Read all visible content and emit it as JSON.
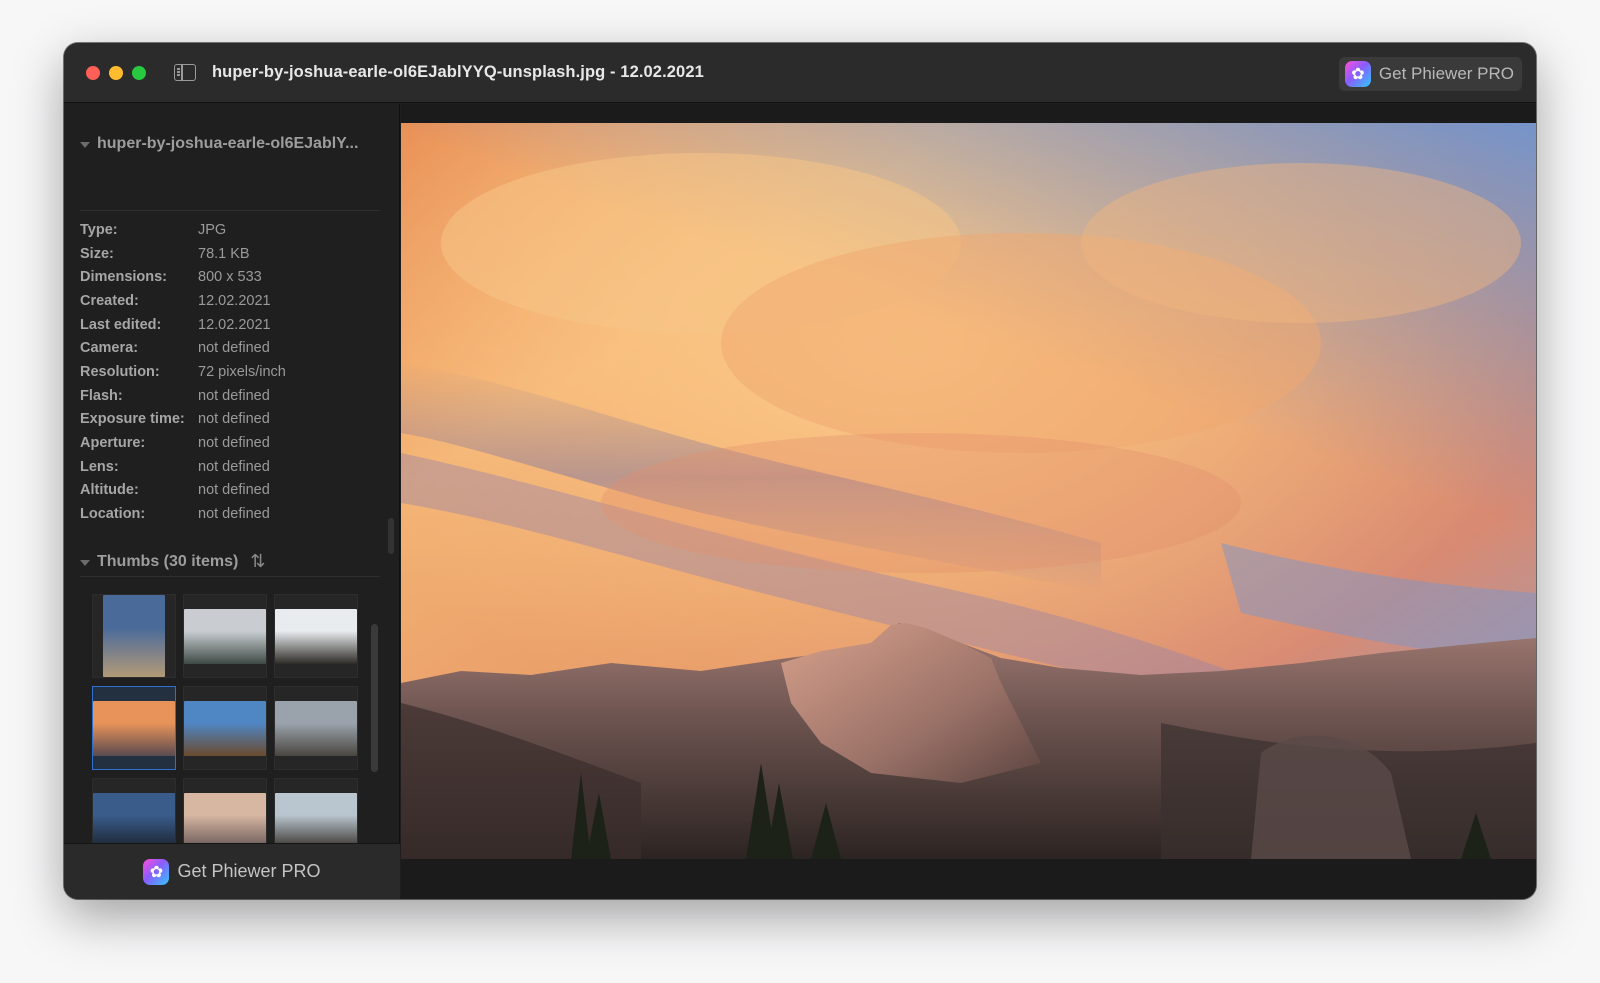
{
  "window": {
    "title": "huper-by-joshua-earle-ol6EJablYYQ-unsplash.jpg - 12.02.2021",
    "pro_button_label": "Get Phiewer PRO"
  },
  "sidebar": {
    "info_header": "huper-by-joshua-earle-ol6EJablY...",
    "info": [
      {
        "label": "Type:",
        "value": "JPG"
      },
      {
        "label": "Size:",
        "value": "78.1 KB"
      },
      {
        "label": "Dimensions:",
        "value": "800 x 533"
      },
      {
        "label": "Created:",
        "value": "12.02.2021"
      },
      {
        "label": "Last edited:",
        "value": "12.02.2021"
      },
      {
        "label": "Camera:",
        "value": "not defined"
      },
      {
        "label": "Resolution:",
        "value": "72 pixels/inch"
      },
      {
        "label": "Flash:",
        "value": "not defined"
      },
      {
        "label": "Exposure time:",
        "value": "not defined"
      },
      {
        "label": "Aperture:",
        "value": "not defined"
      },
      {
        "label": "Lens:",
        "value": "not defined"
      },
      {
        "label": "Altitude:",
        "value": "not defined"
      },
      {
        "label": "Location:",
        "value": "not defined"
      }
    ],
    "thumbs_header": "Thumbs (30 items)",
    "thumbs": [
      {
        "kind": "portrait",
        "colors": [
          "#4a6a9a",
          "#b39a78"
        ]
      },
      {
        "kind": "landscape",
        "colors": [
          "#c9cdd2",
          "#3e4a45"
        ]
      },
      {
        "kind": "landscape",
        "colors": [
          "#e8ecef",
          "#2e2b26"
        ]
      },
      {
        "kind": "landscape",
        "colors": [
          "#e8935a",
          "#5a4a4f"
        ],
        "selected": true
      },
      {
        "kind": "landscape",
        "colors": [
          "#4f86c4",
          "#6b4a2e"
        ]
      },
      {
        "kind": "landscape",
        "colors": [
          "#9aa3ac",
          "#4a4640"
        ]
      },
      {
        "kind": "landscape",
        "colors": [
          "#3a5c8a",
          "#1c2533"
        ]
      },
      {
        "kind": "landscape",
        "colors": [
          "#d7b6a2",
          "#6a5a58"
        ]
      },
      {
        "kind": "landscape",
        "colors": [
          "#b9c6cf",
          "#3a3530"
        ]
      }
    ],
    "footer_label": "Get Phiewer PRO"
  },
  "colors": {
    "close": "#fe5f57",
    "minimize": "#febc2e",
    "zoom": "#28c840",
    "selection": "#2f6fd0"
  }
}
